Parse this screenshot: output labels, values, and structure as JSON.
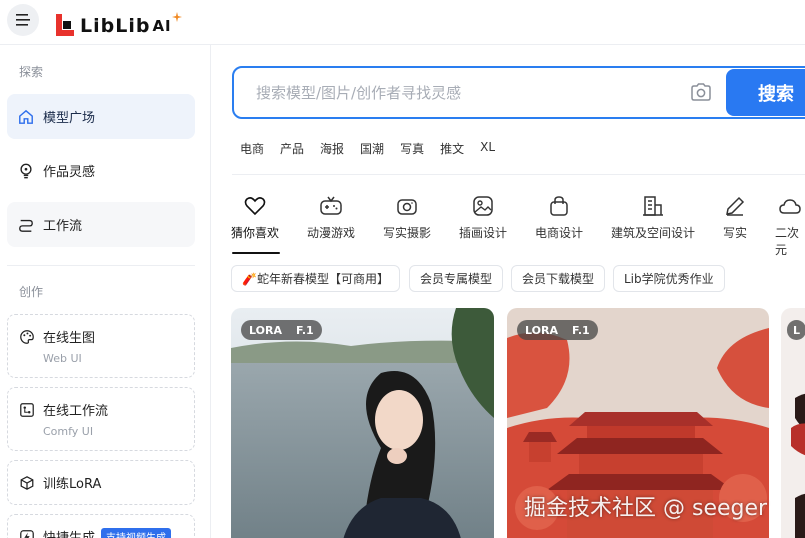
{
  "header": {
    "logo_text": "LibLib",
    "logo_suffix": "AI"
  },
  "sidebar": {
    "explore_label": "探索",
    "items": [
      {
        "label": "模型广场",
        "icon": "home-icon"
      },
      {
        "label": "作品灵感",
        "icon": "lightbulb-icon"
      },
      {
        "label": "工作流",
        "icon": "workflow-icon"
      }
    ],
    "create_label": "创作",
    "tools": [
      {
        "title": "在线生图",
        "sub": "Web UI",
        "icon": "palette-icon"
      },
      {
        "title": "在线工作流",
        "sub": "Comfy UI",
        "icon": "comfy-icon"
      },
      {
        "title": "训练LoRA",
        "sub": "",
        "icon": "cube-icon"
      },
      {
        "title": "快捷生成",
        "sub": "",
        "tag": "支持视频生成",
        "icon": "bolt-icon"
      }
    ]
  },
  "search": {
    "placeholder": "搜索模型/图片/创作者寻找灵感",
    "value": "",
    "button_label": "搜索"
  },
  "hot_words": [
    "电商",
    "产品",
    "海报",
    "国潮",
    "写真",
    "推文",
    "XL"
  ],
  "categories": [
    {
      "label": "猜你喜欢",
      "icon": "heart-icon"
    },
    {
      "label": "动漫游戏",
      "icon": "gamepad-icon"
    },
    {
      "label": "写实摄影",
      "icon": "camera-icon"
    },
    {
      "label": "插画设计",
      "icon": "image-icon"
    },
    {
      "label": "电商设计",
      "icon": "shopping-bag-icon"
    },
    {
      "label": "建筑及空间设计",
      "icon": "building-icon"
    },
    {
      "label": "写实",
      "icon": "pencil-icon"
    },
    {
      "label": "二次元",
      "icon": "cloud-icon"
    }
  ],
  "chips": [
    "🧨蛇年新春模型【可商用】",
    "会员专属模型",
    "会员下载模型",
    "Lib学院优秀作业"
  ],
  "cards": [
    {
      "type": "LORA",
      "version": "F.1"
    },
    {
      "type": "LORA",
      "version": "F.1"
    },
    {
      "type": "L",
      "version": ""
    }
  ],
  "watermark": "掘金技术社区 @ seeger",
  "colors": {
    "accent": "#2979f2",
    "active_nav_bg": "#eef3fb"
  }
}
